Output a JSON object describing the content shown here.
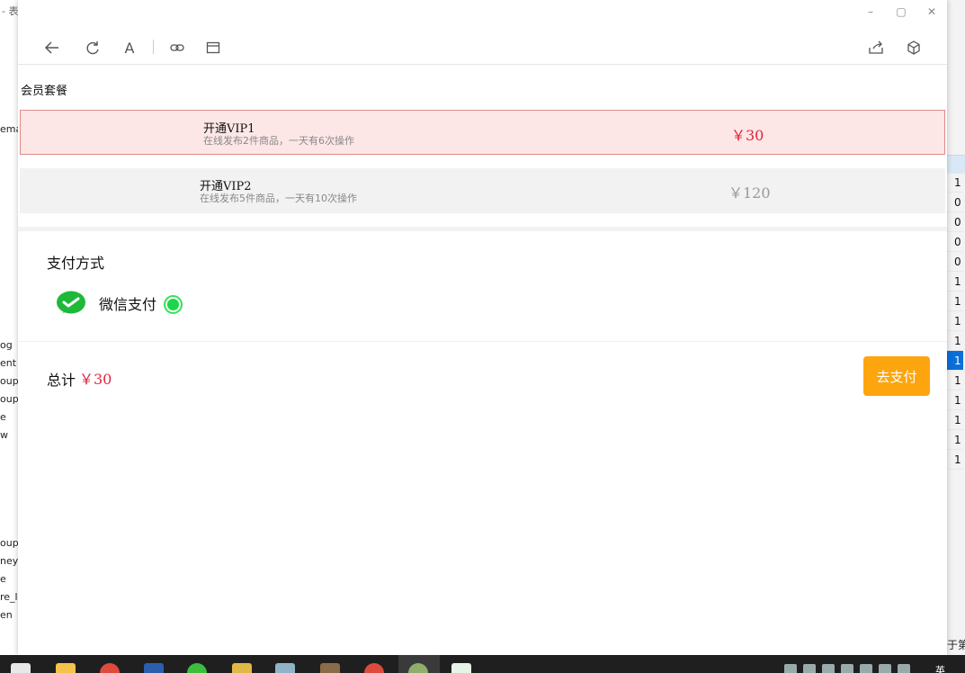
{
  "background_app": {
    "title_fragment": "- 表",
    "left_items": [
      "ema",
      "og",
      "ent",
      "oup",
      "oup_",
      "e",
      "w",
      "oup",
      "ney",
      "e",
      "re_l",
      "en"
    ],
    "right_numbers": [
      "1",
      "0",
      "0",
      "0",
      "0",
      "1",
      "1",
      "1",
      "1",
      "1",
      "1",
      "1",
      "1",
      "1",
      "1"
    ],
    "right_bottom_text": "于第"
  },
  "window": {
    "title_controls": {
      "minimize": "–",
      "maximize": "▢",
      "close": "✕"
    },
    "toolbar": {
      "left_icons": [
        "back-arrow-icon",
        "refresh-icon",
        "font-icon",
        "link-icon",
        "window-icon"
      ],
      "right_icons": [
        "share-icon",
        "cube-icon"
      ],
      "font_glyph": "A"
    }
  },
  "page": {
    "heading": "会员套餐",
    "plans": [
      {
        "name": "开通VIP1",
        "description": "在线发布2件商品，一天有6次操作",
        "price": "￥30",
        "selected": true
      },
      {
        "name": "开通VIP2",
        "description": "在线发布5件商品，一天有10次操作",
        "price": "￥120",
        "selected": false
      }
    ],
    "payment": {
      "heading": "支付方式",
      "method_label": "微信支付",
      "method_selected": true
    },
    "total": {
      "label": "总计",
      "amount": "￥30"
    },
    "pay_button": "去支付"
  },
  "colors": {
    "accent_red": "#e2243b",
    "pay_orange": "#fda50f",
    "wechat_green": "#1ed54a",
    "selected_plan_bg": "#fde6e6",
    "unselected_price": "#999999"
  },
  "taskbar": {
    "apps": [
      "store-icon",
      "folder-icon",
      "chrome-icon",
      "word-icon",
      "wechat-icon",
      "app-icon",
      "phone-icon",
      "sublime-icon",
      "chrome-icon",
      "settings-icon",
      "code-icon"
    ],
    "lang": "英"
  }
}
